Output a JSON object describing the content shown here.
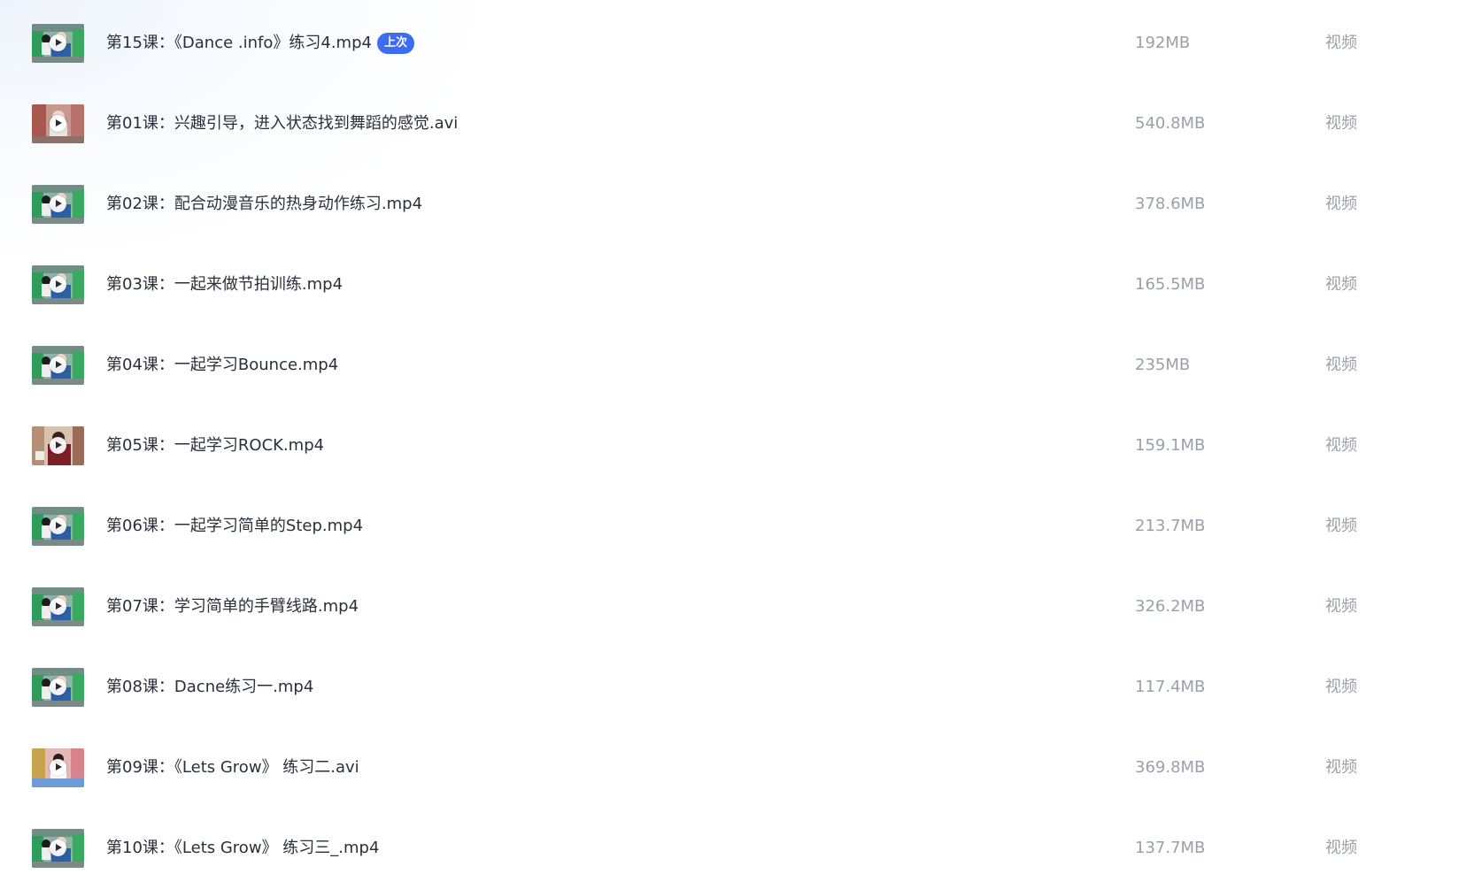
{
  "files": [
    {
      "title": "第15课：《Dance .info》练习4.mp4",
      "badge": "上次",
      "size": "192MB",
      "type": "视频",
      "thumb": "green"
    },
    {
      "title": "第01课：兴趣引导，进入状态找到舞蹈的感觉.avi",
      "size": "540.8MB",
      "type": "视频",
      "thumb": "pink"
    },
    {
      "title": "第02课：配合动漫音乐的热身动作练习.mp4",
      "size": "378.6MB",
      "type": "视频",
      "thumb": "green"
    },
    {
      "title": "第03课：一起来做节拍训练.mp4",
      "size": "165.5MB",
      "type": "视频",
      "thumb": "green"
    },
    {
      "title": "第04课：一起学习Bounce.mp4",
      "size": "235MB",
      "type": "视频",
      "thumb": "green"
    },
    {
      "title": "第05课：一起学习ROCK.mp4",
      "size": "159.1MB",
      "type": "视频",
      "thumb": "red"
    },
    {
      "title": "第06课：一起学习简单的Step.mp4",
      "size": "213.7MB",
      "type": "视频",
      "thumb": "green"
    },
    {
      "title": "第07课：学习简单的手臂线路.mp4",
      "size": "326.2MB",
      "type": "视频",
      "thumb": "green"
    },
    {
      "title": "第08课：Dacne练习一.mp4",
      "size": "117.4MB",
      "type": "视频",
      "thumb": "green"
    },
    {
      "title": "第09课：《Lets Grow》 练习二.avi",
      "size": "369.8MB",
      "type": "视频",
      "thumb": "colorful"
    },
    {
      "title": "第10课：《Lets Grow》 练习三_.mp4",
      "size": "137.7MB",
      "type": "视频",
      "thumb": "green"
    }
  ]
}
